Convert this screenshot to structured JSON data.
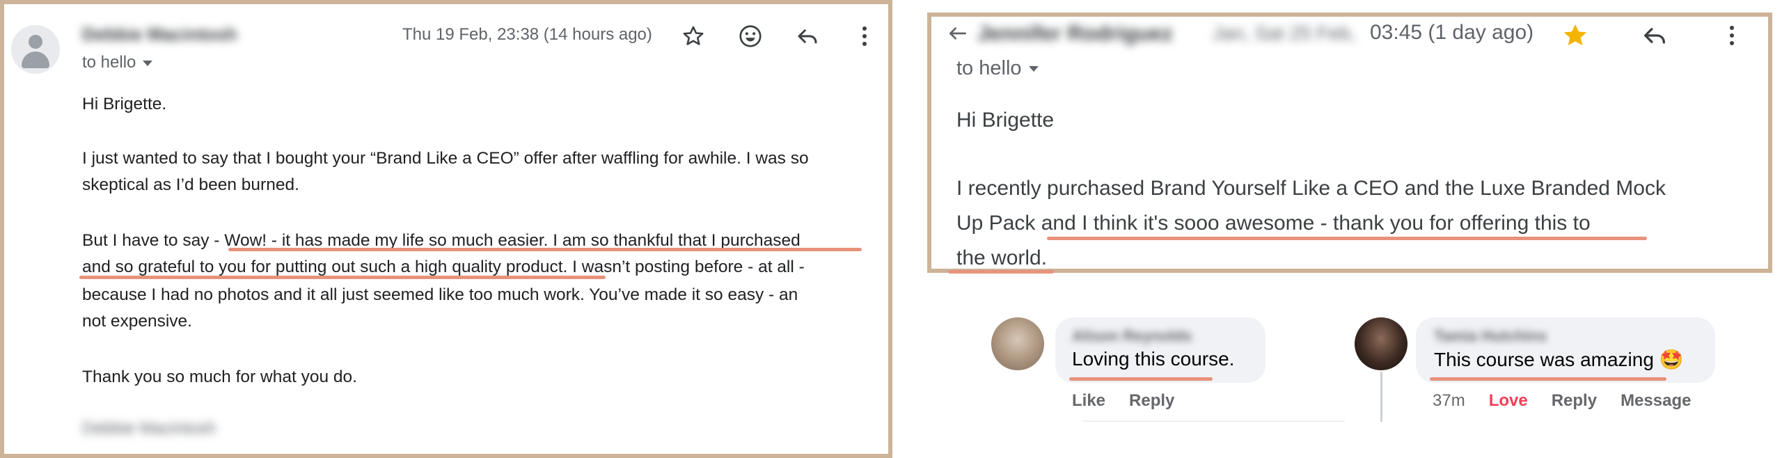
{
  "left_email": {
    "sender_name": "Debbie Macintosh",
    "date": "Thu 19 Feb, 23:38 (14 hours ago)",
    "to_line": "to hello",
    "body_lines": [
      "Hi Brigette.",
      "I just wanted to say that I bought your “Brand Like a CEO” offer after waffling for awhile.  I was so",
      "skeptical as I’d been burned.",
      "But I have to say - Wow! - it has made my life so much easier.  I am so thankful that I purchased",
      "and so grateful to you for putting out such a high quality product.  I wasn’t posting before - at all -",
      "because I had no photos and it all just seemed like too much work.  You’ve made it so easy - an",
      "not expensive.",
      "Thank you so much for what you do."
    ],
    "signature": "Debbie Macintosh",
    "icons": [
      "star-icon",
      "emoji-icon",
      "reply-icon",
      "more-icon"
    ]
  },
  "right_email": {
    "sender_name": "Jennifer Rodriguez",
    "date_blurred": "Jan, Sat 25 Feb,",
    "date_visible": "03:45 (1 day ago)",
    "to_line": "to hello",
    "body_lines": [
      "Hi Brigette",
      "I recently purchased Brand Yourself Like a CEO and the Luxe Branded Mock",
      "Up Pack and I think it's sooo awesome - thank you for offering this to",
      "the world."
    ],
    "starred_color": "#f4b400"
  },
  "comments": [
    {
      "name": "Alison Reynolds",
      "text": "Loving this course.",
      "actions": [
        "Like",
        "Reply"
      ]
    },
    {
      "name": "Tamia Hutchins",
      "text": "This course was amazing",
      "emoji": "🤩",
      "time": "37m",
      "reaction": "Love",
      "actions": [
        "Reply",
        "Message"
      ]
    }
  ],
  "colors": {
    "frame": "#cdb398",
    "underline": "#e8927c",
    "love": "#f33e58"
  }
}
